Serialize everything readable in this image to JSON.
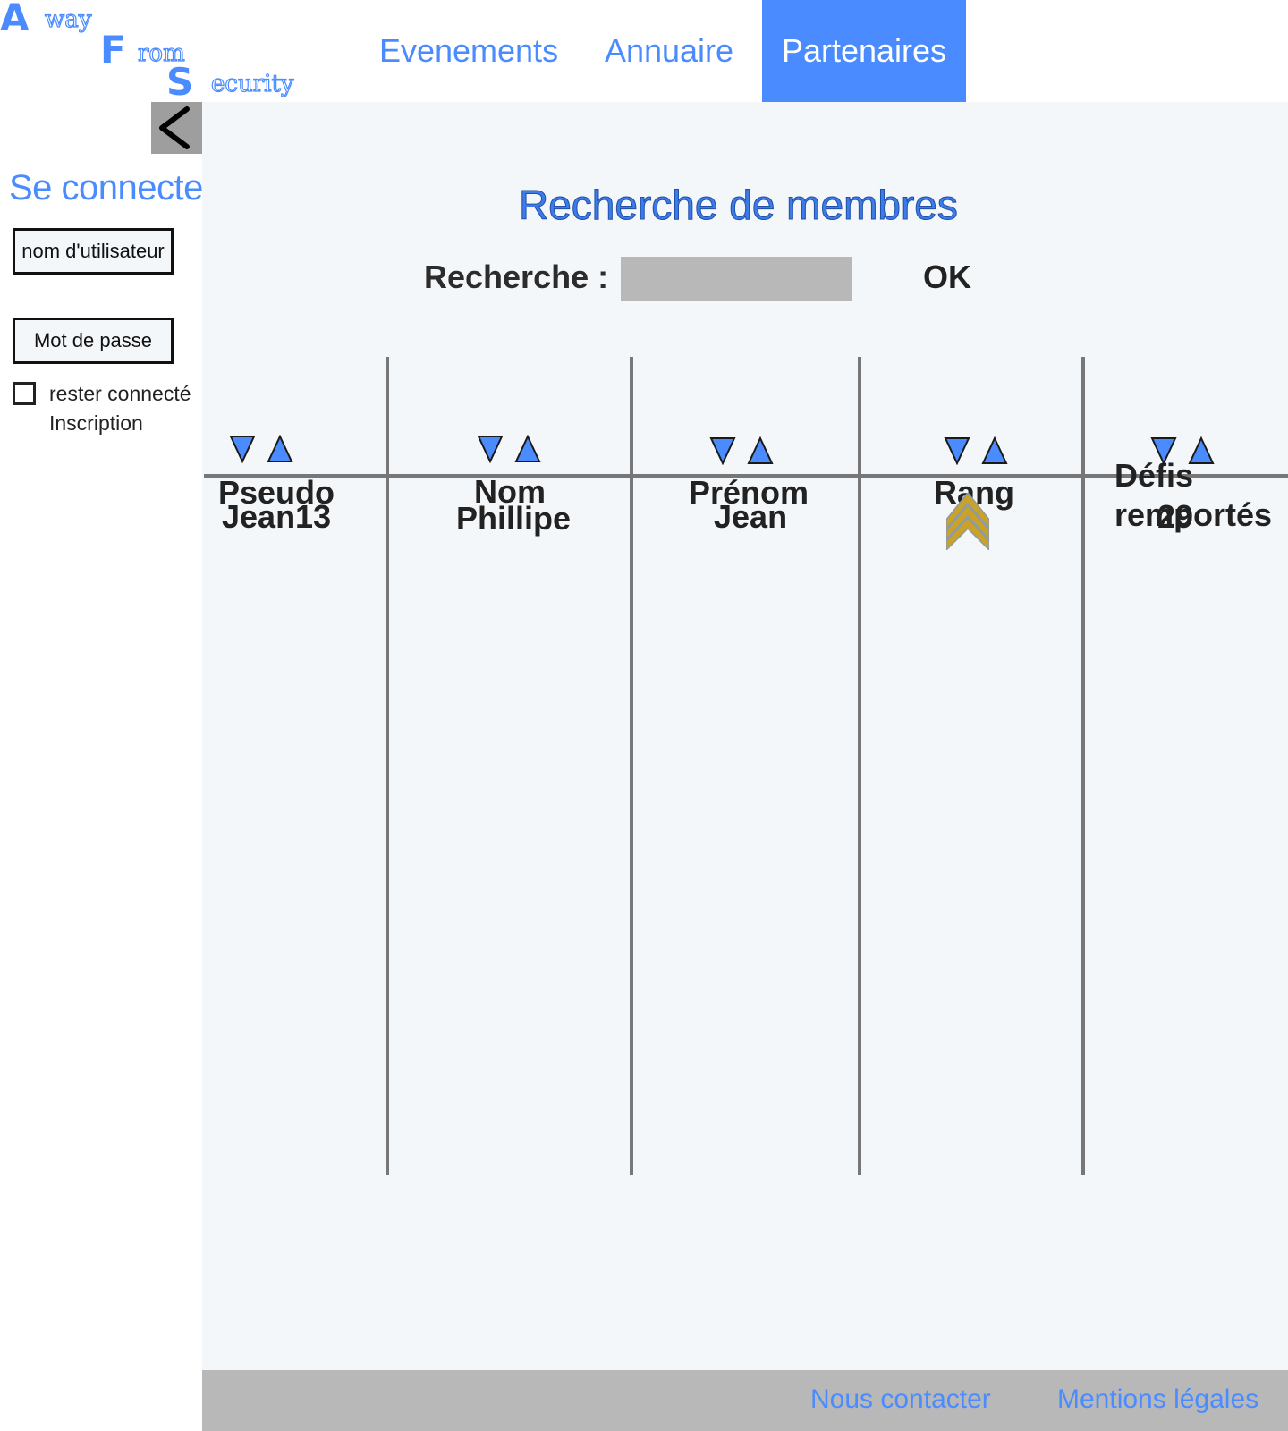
{
  "logo": {
    "line1": [
      "A",
      "way"
    ],
    "line2": [
      "F",
      "rom"
    ],
    "line3": [
      "S",
      "ecurity"
    ]
  },
  "nav": [
    {
      "label": "Evenements",
      "active": false
    },
    {
      "label": "Annuaire",
      "active": false
    },
    {
      "label": "Partenaires",
      "active": true
    }
  ],
  "sidebar": {
    "collapse_icon": "chevron-left-icon",
    "title": "Se connecter",
    "username_placeholder": "nom d'utilisateur",
    "password_placeholder": "Mot de passe",
    "remember_label": "rester connecté",
    "signup_label": "Inscription"
  },
  "main": {
    "title": "Recherche de membres",
    "search_label": "Recherche :",
    "search_value": "",
    "ok_label": "OK"
  },
  "table": {
    "columns": [
      "Pseudo",
      "Nom",
      "Prénom",
      "Rang",
      "Défis remportés"
    ],
    "sort_icons": [
      "sort-descending-icon",
      "sort-ascending-icon"
    ],
    "rows": [
      {
        "pseudo": "Jean13",
        "nom": "Phillipe",
        "prenom": "Jean",
        "rang_icon": "sergeant-chevron-icon",
        "defis": "29"
      }
    ]
  },
  "footer": {
    "contact": "Nous contacter",
    "legal": "Mentions légales"
  },
  "colors": {
    "accent": "#4a8cff",
    "panel": "#f4f7fa",
    "gray": "#b8b8b8",
    "rank_gold": "#c9a227",
    "rank_steel": "#8c9aa8"
  }
}
